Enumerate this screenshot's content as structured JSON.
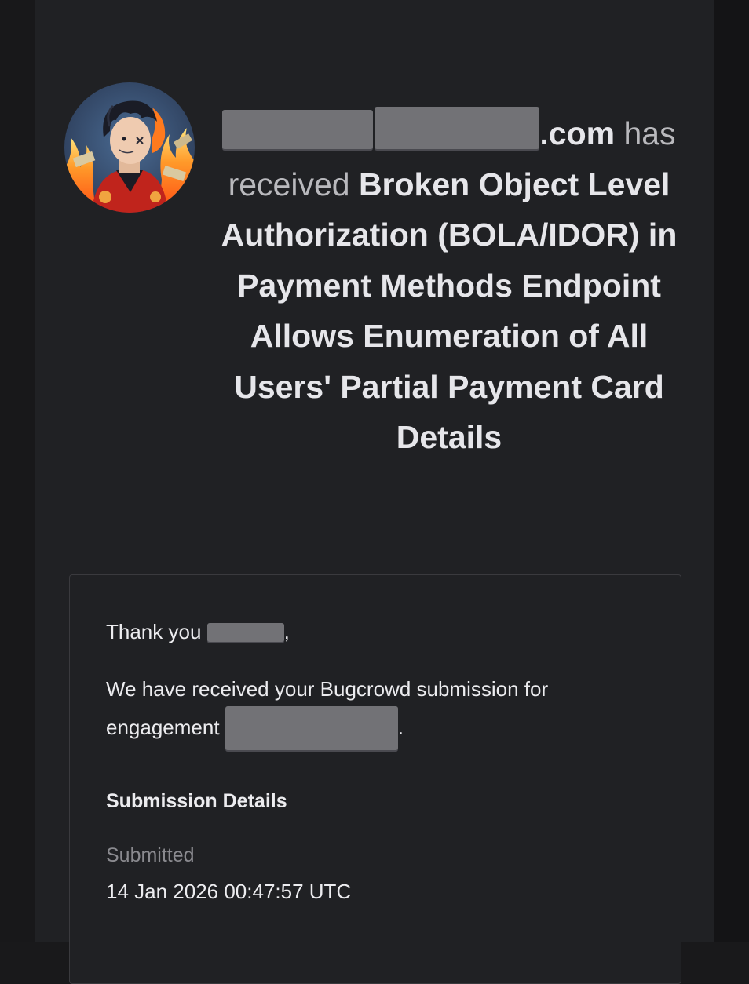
{
  "headline": {
    "domain_suffix": ".com",
    "has": " has",
    "received": "received ",
    "title": "Broken Object Level Authorization (BOLA/IDOR) in Payment Methods Endpoint Allows Enumeration of All Users' Partial Payment Card Details"
  },
  "message": {
    "thank_you": "Thank you ",
    "thank_you_suffix": ",",
    "received_text": "We have received your Bugcrowd submission for engagement ",
    "received_suffix": ".",
    "section_title": "Submission Details",
    "submitted_label": "Submitted",
    "submitted_value": "14 Jan 2026 00:47:57 UTC"
  },
  "colors": {
    "background": "#202124",
    "redaction": "#727276",
    "text_primary": "#ececef",
    "text_secondary": "#8a8a8f"
  },
  "icons": {
    "avatar": "avatar-illustration"
  }
}
